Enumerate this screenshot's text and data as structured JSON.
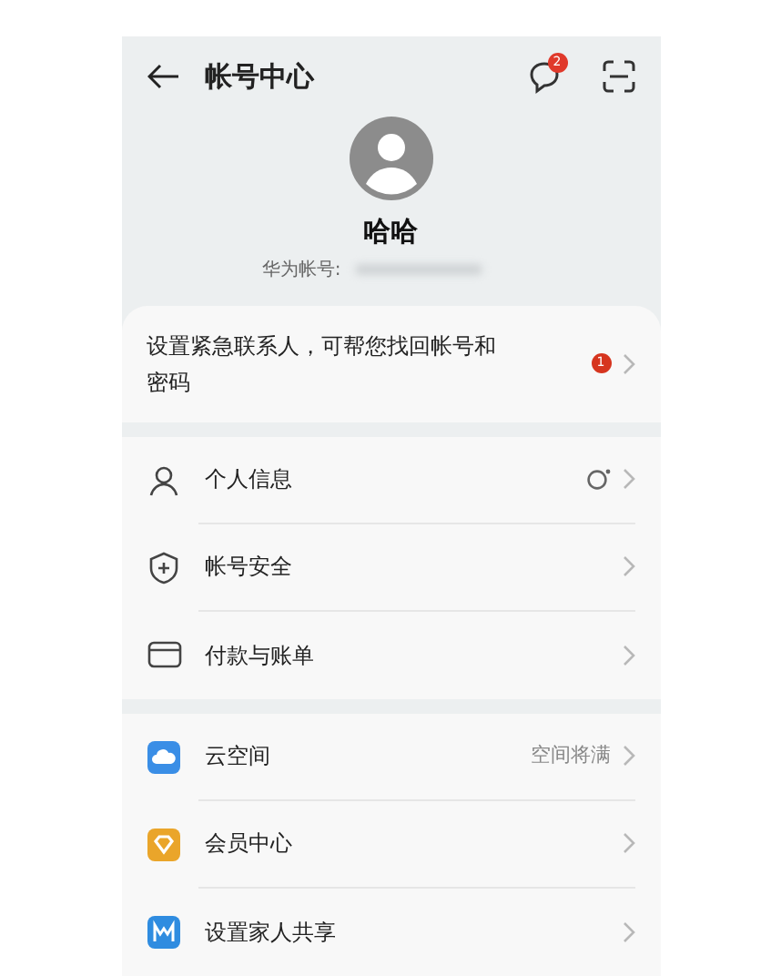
{
  "header": {
    "title": "帐号中心",
    "message_badge": "2"
  },
  "profile": {
    "name": "哈哈",
    "account_label": "华为帐号:"
  },
  "notice": {
    "text": "设置紧急联系人，可帮您找回帐号和密码",
    "badge": "1"
  },
  "groups": [
    {
      "items": [
        {
          "kind": "person",
          "label": "个人信息",
          "indicator": true
        },
        {
          "kind": "shield",
          "label": "帐号安全"
        },
        {
          "kind": "card",
          "label": "付款与账单"
        }
      ]
    },
    {
      "items": [
        {
          "kind": "cloud",
          "label": "云空间",
          "value": "空间将满"
        },
        {
          "kind": "member",
          "label": "会员中心"
        },
        {
          "kind": "family",
          "label": "设置家人共享"
        }
      ]
    }
  ]
}
